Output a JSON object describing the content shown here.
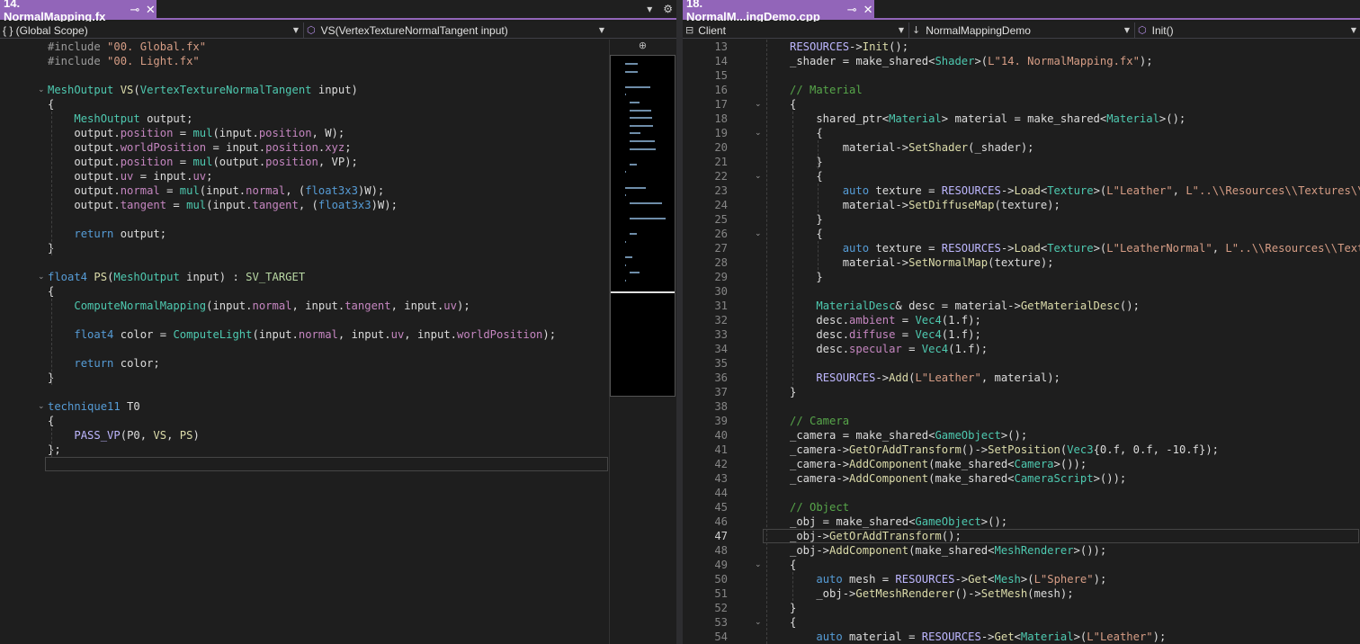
{
  "left": {
    "tab": {
      "title": "14. NormalMapping.fx",
      "pin": "⊸",
      "close": "✕"
    },
    "tools": {
      "dropdown": "▾",
      "settings": "⚙"
    },
    "nav": {
      "scope": "{ } (Global Scope)",
      "member": "VS(VertexTextureNormalTangent input)"
    },
    "minimap_split": "⊕",
    "lines": [
      {
        "text": "#include \"00. Global.fx\""
      },
      {
        "text": "#include \"00. Light.fx\""
      },
      {
        "text": ""
      },
      {
        "text": "MeshOutput VS(VertexTextureNormalTangent input)",
        "fold": true
      },
      {
        "text": "{"
      },
      {
        "text": "    MeshOutput output;"
      },
      {
        "text": "    output.position = mul(input.position, W);"
      },
      {
        "text": "    output.worldPosition = input.position.xyz;"
      },
      {
        "text": "    output.position = mul(output.position, VP);"
      },
      {
        "text": "    output.uv = input.uv;"
      },
      {
        "text": "    output.normal = mul(input.normal, (float3x3)W);"
      },
      {
        "text": "    output.tangent = mul(input.tangent, (float3x3)W);"
      },
      {
        "text": ""
      },
      {
        "text": "    return output;"
      },
      {
        "text": "}"
      },
      {
        "text": ""
      },
      {
        "text": "float4 PS(MeshOutput input) : SV_TARGET",
        "fold": true
      },
      {
        "text": "{"
      },
      {
        "text": "    ComputeNormalMapping(input.normal, input.tangent, input.uv);"
      },
      {
        "text": ""
      },
      {
        "text": "    float4 color = ComputeLight(input.normal, input.uv, input.worldPosition);"
      },
      {
        "text": ""
      },
      {
        "text": "    return color;"
      },
      {
        "text": "}"
      },
      {
        "text": ""
      },
      {
        "text": "technique11 T0",
        "fold": true
      },
      {
        "text": "{"
      },
      {
        "text": "    PASS_VP(P0, VS, PS)"
      },
      {
        "text": "};"
      }
    ]
  },
  "right": {
    "tab": {
      "title": "18. NormalM...ingDemo.cpp",
      "pin": "⊸",
      "close": "✕"
    },
    "nav": {
      "project": "Client",
      "class": "NormalMappingDemo",
      "member": "Init()"
    },
    "current_line": "47",
    "lines": [
      {
        "num": "13",
        "text": "RESOURCES->Init();"
      },
      {
        "num": "14",
        "text": "_shader = make_shared<Shader>(L\"14. NormalMapping.fx\");"
      },
      {
        "num": "15",
        "text": ""
      },
      {
        "num": "16",
        "text": "// Material"
      },
      {
        "num": "17",
        "text": "{",
        "fold": true
      },
      {
        "num": "18",
        "text": "    shared_ptr<Material> material = make_shared<Material>();"
      },
      {
        "num": "19",
        "text": "    {",
        "fold": true
      },
      {
        "num": "20",
        "text": "        material->SetShader(_shader);"
      },
      {
        "num": "21",
        "text": "    }"
      },
      {
        "num": "22",
        "text": "    {",
        "fold": true
      },
      {
        "num": "23",
        "text": "        auto texture = RESOURCES->Load<Texture>(L\"Leather\", L\"..\\\\Resources\\\\Textures\\\\Leather.jpg\");"
      },
      {
        "num": "24",
        "text": "        material->SetDiffuseMap(texture);"
      },
      {
        "num": "25",
        "text": "    }"
      },
      {
        "num": "26",
        "text": "    {",
        "fold": true
      },
      {
        "num": "27",
        "text": "        auto texture = RESOURCES->Load<Texture>(L\"LeatherNormal\", L\"..\\\\Resources\\\\Textures\\\\Leather_Normal.jpg\");"
      },
      {
        "num": "28",
        "text": "        material->SetNormalMap(texture);"
      },
      {
        "num": "29",
        "text": "    }"
      },
      {
        "num": "30",
        "text": ""
      },
      {
        "num": "31",
        "text": "    MaterialDesc& desc = material->GetMaterialDesc();"
      },
      {
        "num": "32",
        "text": "    desc.ambient = Vec4(1.f);"
      },
      {
        "num": "33",
        "text": "    desc.diffuse = Vec4(1.f);"
      },
      {
        "num": "34",
        "text": "    desc.specular = Vec4(1.f);"
      },
      {
        "num": "35",
        "text": ""
      },
      {
        "num": "36",
        "text": "    RESOURCES->Add(L\"Leather\", material);"
      },
      {
        "num": "37",
        "text": "}"
      },
      {
        "num": "38",
        "text": ""
      },
      {
        "num": "39",
        "text": "// Camera"
      },
      {
        "num": "40",
        "text": "_camera = make_shared<GameObject>();"
      },
      {
        "num": "41",
        "text": "_camera->GetOrAddTransform()->SetPosition(Vec3{0.f, 0.f, -10.f});"
      },
      {
        "num": "42",
        "text": "_camera->AddComponent(make_shared<Camera>());"
      },
      {
        "num": "43",
        "text": "_camera->AddComponent(make_shared<CameraScript>());"
      },
      {
        "num": "44",
        "text": ""
      },
      {
        "num": "45",
        "text": "// Object"
      },
      {
        "num": "46",
        "text": "_obj = make_shared<GameObject>();"
      },
      {
        "num": "47",
        "text": "_obj->GetOrAddTransform();"
      },
      {
        "num": "48",
        "text": "_obj->AddComponent(make_shared<MeshRenderer>());"
      },
      {
        "num": "49",
        "text": "{",
        "fold": true
      },
      {
        "num": "50",
        "text": "    auto mesh = RESOURCES->Get<Mesh>(L\"Sphere\");"
      },
      {
        "num": "51",
        "text": "    _obj->GetMeshRenderer()->SetMesh(mesh);"
      },
      {
        "num": "52",
        "text": "}"
      },
      {
        "num": "53",
        "text": "{",
        "fold": true
      },
      {
        "num": "54",
        "text": "    auto material = RESOURCES->Get<Material>(L\"Leather\");"
      }
    ]
  },
  "colors": {
    "tab_accent": "#9265b9",
    "editor_bg": "#1e1e1e"
  }
}
